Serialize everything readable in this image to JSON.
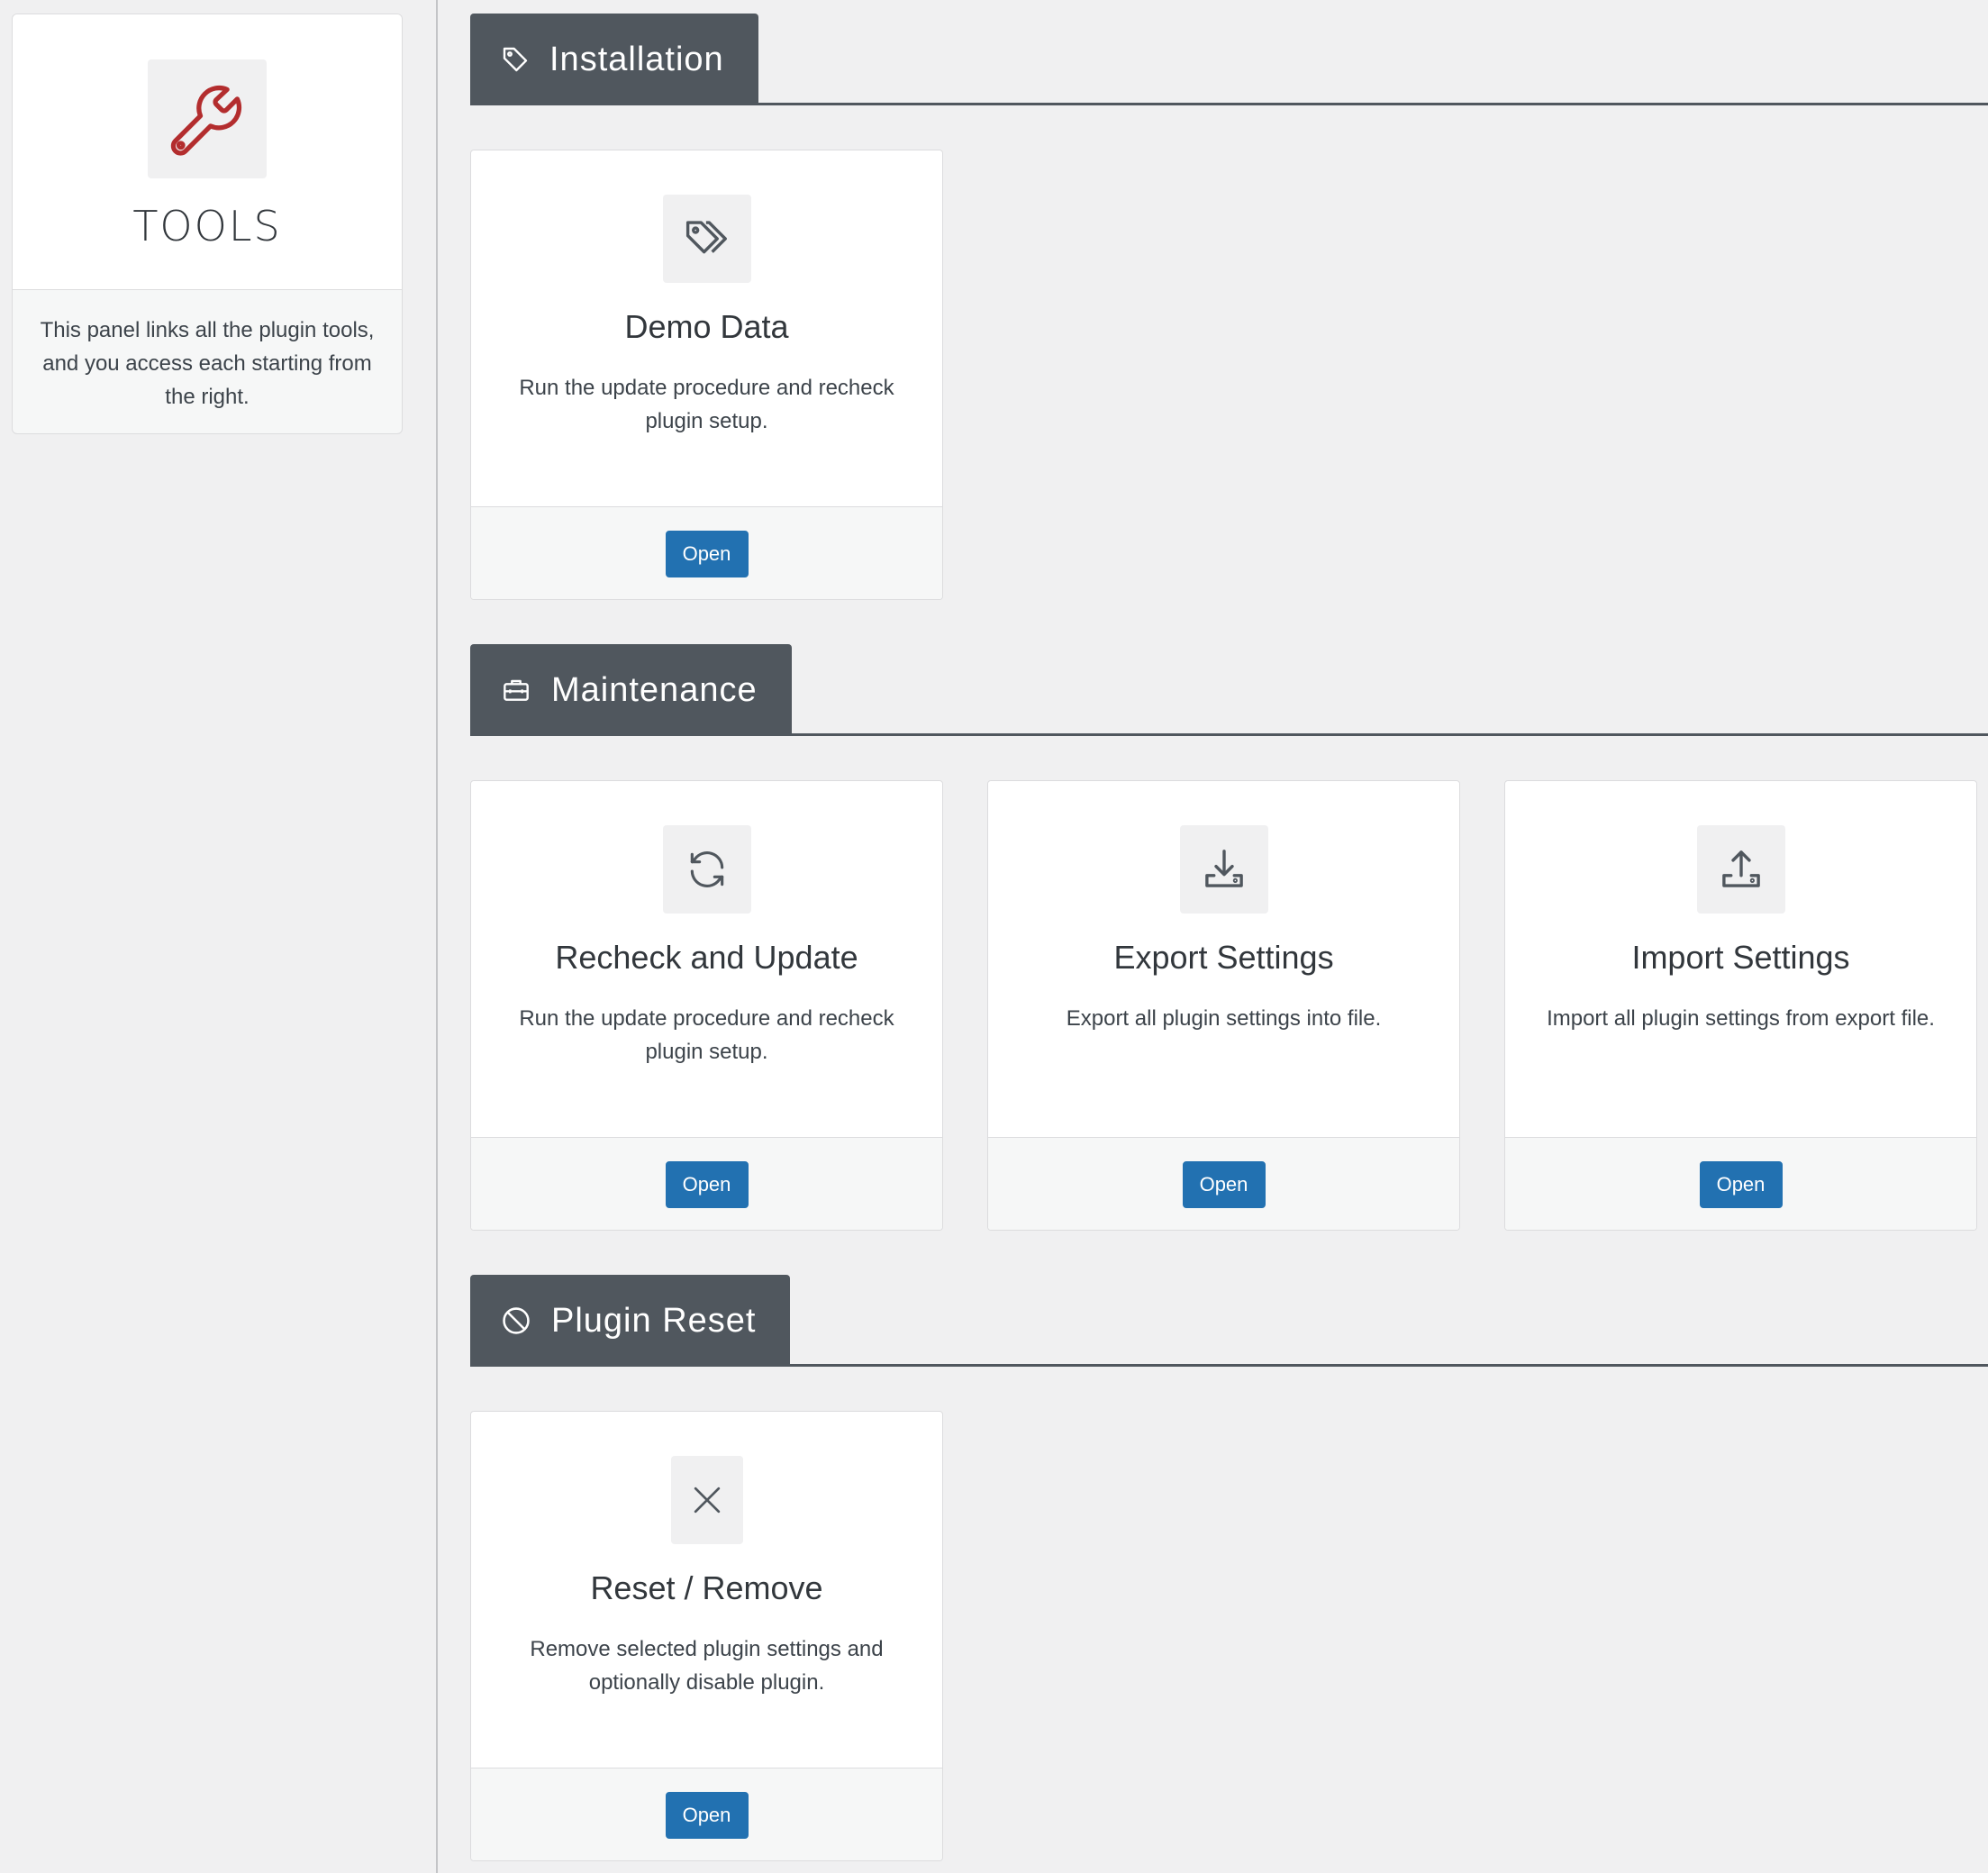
{
  "sidebar": {
    "title": "TOOLS",
    "icon": "wrench-icon",
    "description": "This panel links all the plugin tools, and you access each starting from the right.",
    "accent_color": "#b32d2e"
  },
  "sections": {
    "installation": {
      "label": "Installation",
      "icon": "tag-icon",
      "cards": [
        {
          "title": "Demo Data",
          "icon": "tags-icon",
          "description": "Run the update procedure and recheck plugin setup.",
          "button": "Open"
        }
      ]
    },
    "maintenance": {
      "label": "Maintenance",
      "icon": "toolbox-icon",
      "cards": [
        {
          "title": "Recheck and Update",
          "icon": "refresh-icon",
          "description": "Run the update procedure and recheck plugin setup.",
          "button": "Open"
        },
        {
          "title": "Export Settings",
          "icon": "download-icon",
          "description": "Export all plugin settings into file.",
          "button": "Open"
        },
        {
          "title": "Import Settings",
          "icon": "upload-icon",
          "description": "Import all plugin settings from export file.",
          "button": "Open"
        }
      ]
    },
    "reset": {
      "label": "Plugin Reset",
      "icon": "ban-icon",
      "cards": [
        {
          "title": "Reset / Remove",
          "icon": "close-icon",
          "description": "Remove selected plugin settings and optionally disable plugin.",
          "button": "Open"
        }
      ]
    }
  },
  "colors": {
    "button": "#2271b1",
    "section_tab": "#50575e",
    "background": "#f0f0f1"
  }
}
